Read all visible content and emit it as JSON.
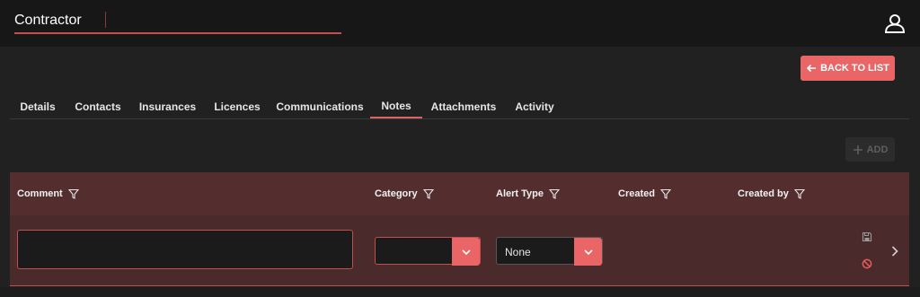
{
  "header": {
    "title": "Contractor",
    "user_icon": "user-icon"
  },
  "actions": {
    "back_label": "BACK TO LIST",
    "add_label": "ADD"
  },
  "tabs": [
    {
      "label": "Details"
    },
    {
      "label": "Contacts"
    },
    {
      "label": "Insurances"
    },
    {
      "label": "Licences"
    },
    {
      "label": "Communications"
    },
    {
      "label": "Notes",
      "active": true
    },
    {
      "label": "Attachments"
    },
    {
      "label": "Activity"
    }
  ],
  "grid": {
    "columns": [
      {
        "label": "Comment"
      },
      {
        "label": "Category"
      },
      {
        "label": "Alert Type"
      },
      {
        "label": "Created"
      },
      {
        "label": "Created by"
      }
    ],
    "edit_row": {
      "comment_value": "",
      "category_value": "",
      "alert_type_value": "None"
    }
  },
  "colors": {
    "accent": "#ea6565",
    "header_bg": "#542e2f",
    "row_bg": "#4b2a2b"
  }
}
